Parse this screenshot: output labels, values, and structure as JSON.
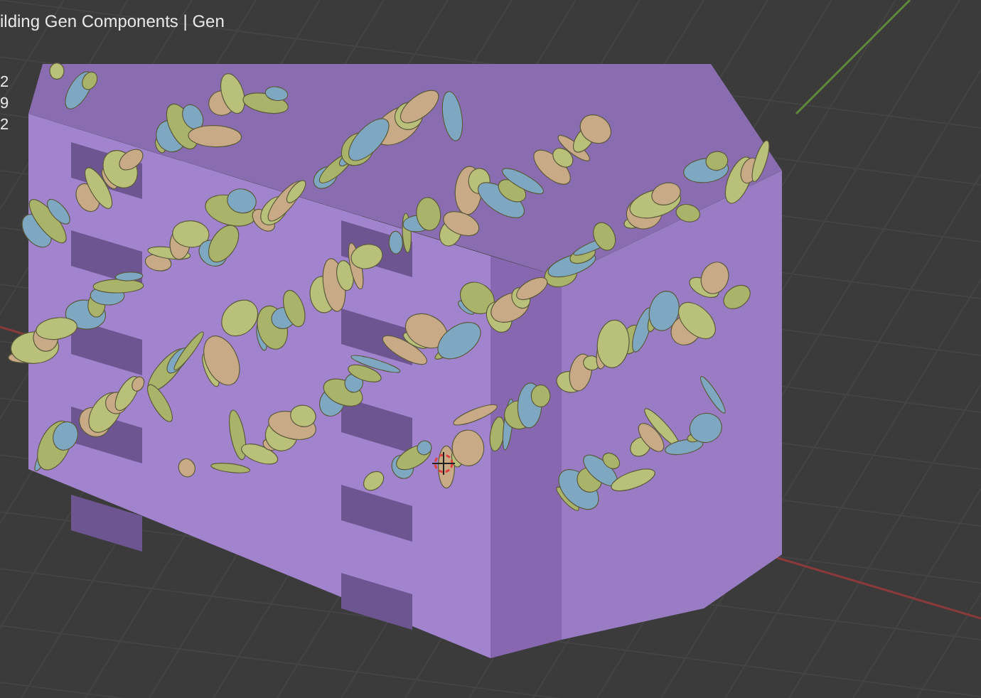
{
  "viewport": {
    "title": "ilding Gen Components | Gen",
    "stats": [
      "2",
      "9",
      "2"
    ]
  }
}
